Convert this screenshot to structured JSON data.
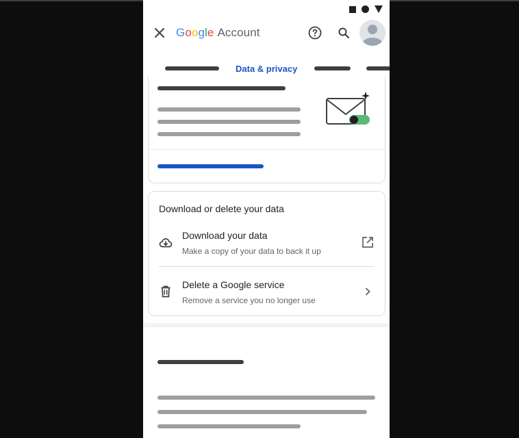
{
  "header": {
    "logo_letters": [
      "G",
      "o",
      "o",
      "g",
      "l",
      "e"
    ],
    "logo_colors": [
      "#4285F4",
      "#EA4335",
      "#FBBC05",
      "#4285F4",
      "#34A853",
      "#EA4335"
    ],
    "logo_suffix": "Account",
    "icons": [
      "close-icon",
      "help-icon",
      "search-icon",
      "avatar"
    ]
  },
  "tabs": {
    "active_label": "Data & privacy"
  },
  "download_card": {
    "title": "Download or delete your data",
    "rows": [
      {
        "title": "Download your data",
        "subtitle": "Make a copy of your data to back it up",
        "icon": "cloud-download-icon",
        "trailing_icon": "open-external-icon"
      },
      {
        "title": "Delete a Google service",
        "subtitle": "Remove a service you no longer use",
        "icon": "trash-icon",
        "trailing_icon": "chevron-right-icon"
      }
    ]
  },
  "colors": {
    "accent": "#1a57c4",
    "toggle_green": "#5bb974"
  }
}
